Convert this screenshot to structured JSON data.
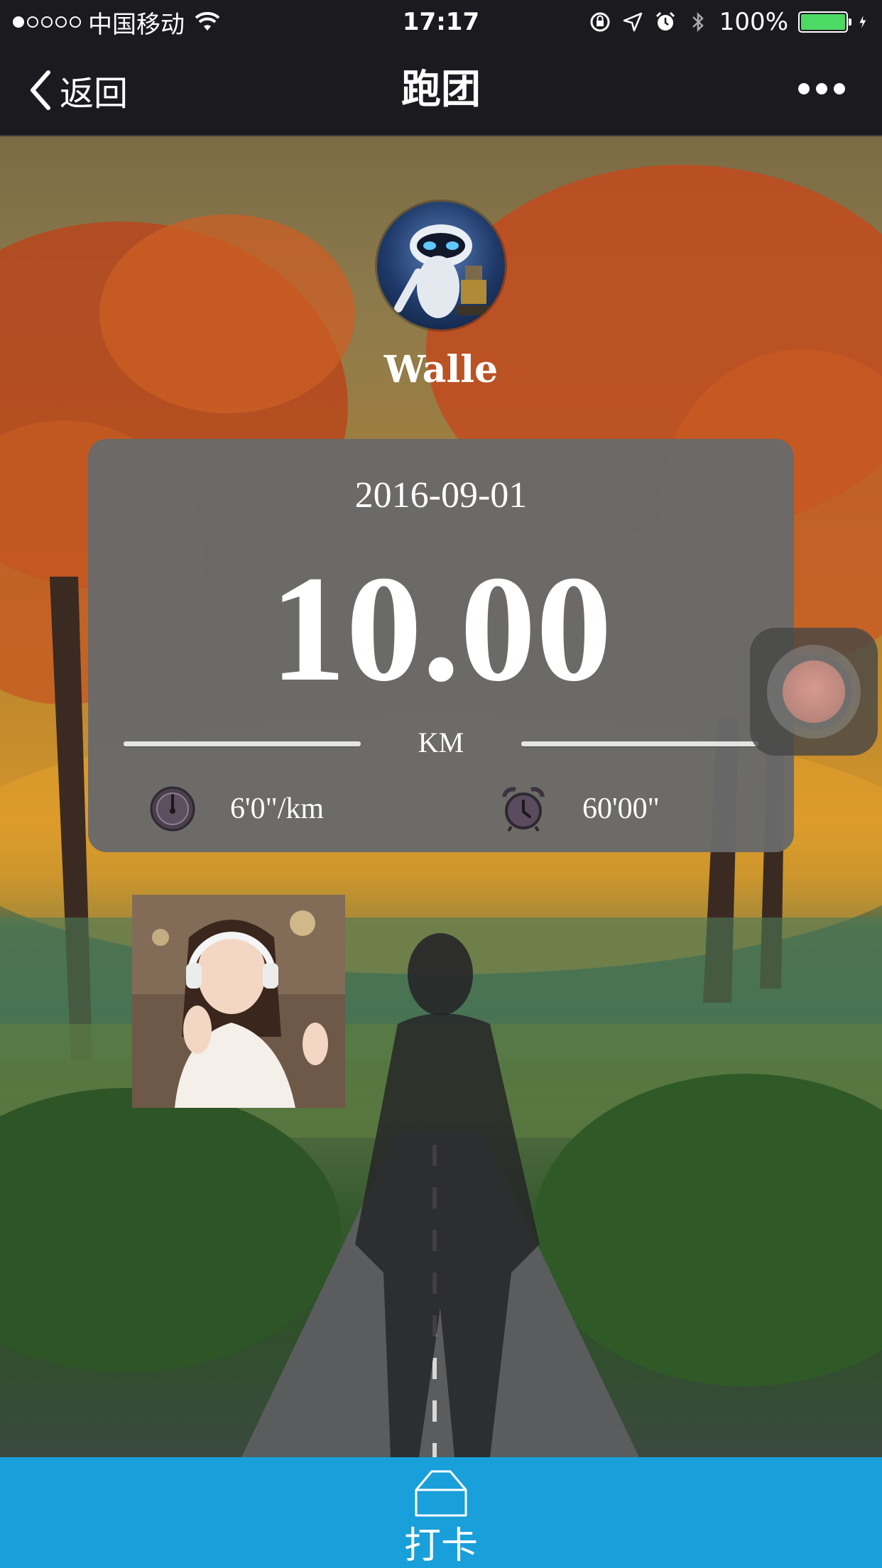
{
  "status_bar": {
    "carrier": "中国移动",
    "time": "17:17",
    "battery": "100%",
    "signal_strength_dots": 1
  },
  "nav": {
    "back_label": "返回",
    "title": "跑团"
  },
  "profile": {
    "name": "Walle"
  },
  "run": {
    "date": "2016-09-01",
    "distance": "10.00",
    "unit": "KM",
    "pace": "6'0\"/km",
    "duration": "60'00\""
  },
  "checkin": {
    "label": "打卡"
  },
  "colors": {
    "nav_background": "#1b1a1f",
    "card_background": "#6b6b6b",
    "checkin_bar": "#199fd9",
    "battery_fill": "#4cd964"
  },
  "icons": {
    "pace": "speedometer-icon",
    "duration": "alarm-clock-icon",
    "checkin": "house-outline-icon",
    "back": "chevron-left-icon",
    "more": "more-dots-icon"
  }
}
